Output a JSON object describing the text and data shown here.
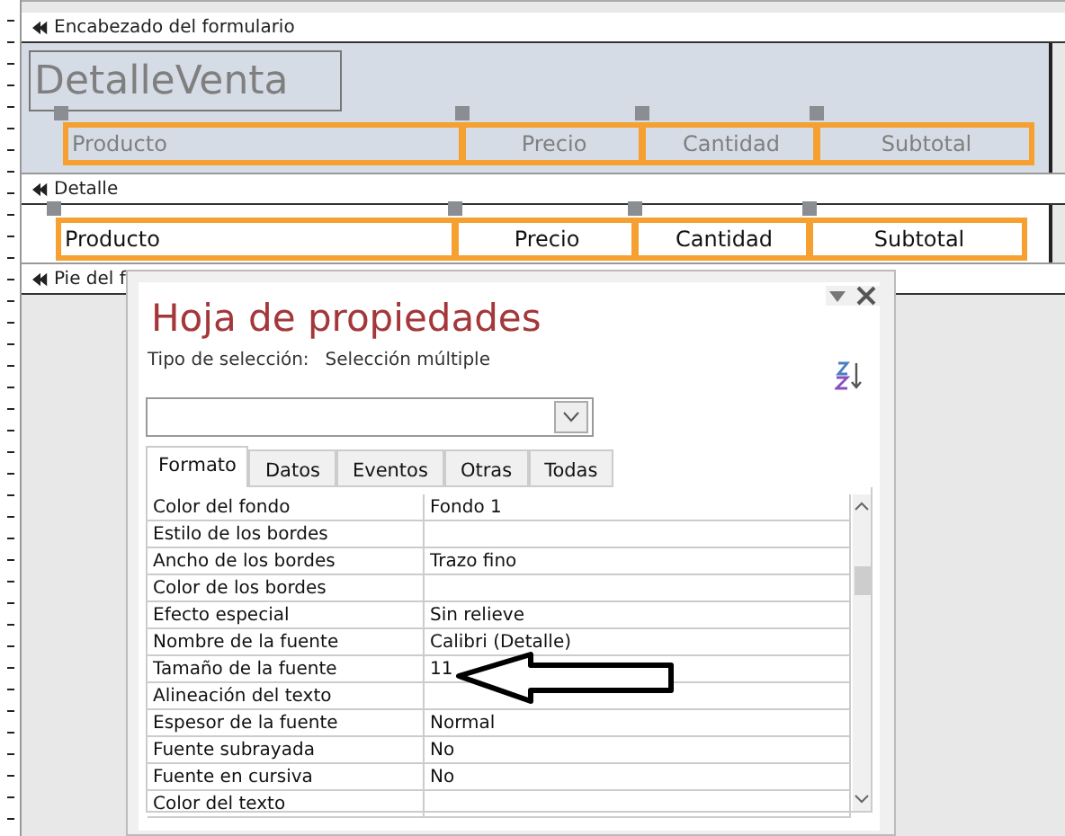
{
  "form_designer": {
    "sections": [
      {
        "kind": "header",
        "title": "Encabezado del formulario"
      },
      {
        "kind": "detail",
        "title": "Detalle"
      },
      {
        "kind": "footer",
        "title": "Pie del f"
      }
    ],
    "header_title": "DetalleVenta",
    "header_labels": [
      {
        "text": "Producto"
      },
      {
        "text": "Precio"
      },
      {
        "text": "Cantidad"
      },
      {
        "text": "Subtotal"
      }
    ],
    "detail_fields": [
      {
        "text": "Producto"
      },
      {
        "text": "Precio"
      },
      {
        "text": "Cantidad"
      },
      {
        "text": "Subtotal"
      }
    ]
  },
  "property_sheet": {
    "title": "Hoja de propiedades",
    "selection_label": "Tipo de selección:",
    "selection_value": "Selección múltiple",
    "tabs": [
      {
        "label": "Formato",
        "selected": true
      },
      {
        "label": "Datos",
        "selected": false
      },
      {
        "label": "Eventos",
        "selected": false
      },
      {
        "label": "Otras",
        "selected": false
      },
      {
        "label": "Todas",
        "selected": false
      }
    ],
    "properties": [
      {
        "name": "Color del fondo",
        "value": "Fondo 1"
      },
      {
        "name": "Estilo de los bordes"
      },
      {
        "name": "Ancho de los bordes",
        "value": "Trazo fino"
      },
      {
        "name": "Color de los bordes"
      },
      {
        "name": "Efecto especial",
        "value": "Sin relieve"
      },
      {
        "name": "Nombre de la fuente",
        "value": "Calibri (Detalle)"
      },
      {
        "name": "Tamaño de la fuente",
        "value": "11"
      },
      {
        "name": "Alineación del texto"
      },
      {
        "name": "Espesor de la fuente",
        "value": "Normal"
      },
      {
        "name": "Fuente subrayada",
        "value": "No"
      },
      {
        "name": "Fuente en cursiva",
        "value": "No"
      },
      {
        "name": "Color del texto"
      }
    ]
  }
}
